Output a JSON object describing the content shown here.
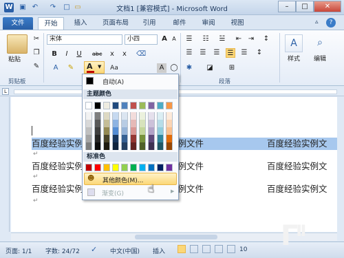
{
  "title": "文档1 [兼容模式] - Microsoft Word",
  "tabs": {
    "file": "文件",
    "items": [
      "开始",
      "插入",
      "页面布局",
      "引用",
      "邮件",
      "审阅",
      "视图"
    ]
  },
  "ribbon": {
    "paste_label": "粘贴",
    "clipboard_group": "剪贴板",
    "font_name": "宋体",
    "font_size": "小四",
    "paragraph_group": "段落",
    "style_label": "样式",
    "edit_label": "编辑",
    "font_color_hex": "#c00000"
  },
  "color_menu": {
    "auto_label": "自动(A)",
    "theme_header": "主题颜色",
    "theme_top_row": [
      "#ffffff",
      "#000000",
      "#eeece1",
      "#1f497d",
      "#4f81bd",
      "#c0504d",
      "#9bbb59",
      "#8064a2",
      "#4bacc6",
      "#f79646"
    ],
    "theme_shades": [
      [
        "#f2f2f2",
        "#7f7f7f",
        "#ddd9c3",
        "#c6d9f0",
        "#dbe5f1",
        "#f2dcdb",
        "#ebf1dd",
        "#e5e0ec",
        "#dbeef3",
        "#fdeada"
      ],
      [
        "#d8d8d8",
        "#595959",
        "#c4bd97",
        "#8db3e2",
        "#b8cce4",
        "#e5b9b7",
        "#d7e3bc",
        "#ccc1d9",
        "#b7dde8",
        "#fbd5b5"
      ],
      [
        "#bfbfbf",
        "#3f3f3f",
        "#938953",
        "#548dd4",
        "#95b3d7",
        "#d99694",
        "#c3d69b",
        "#b2a2c7",
        "#92cddc",
        "#fac08f"
      ],
      [
        "#a5a5a5",
        "#262626",
        "#494429",
        "#17365d",
        "#366092",
        "#953734",
        "#76923c",
        "#5f497a",
        "#31859b",
        "#e36c09"
      ],
      [
        "#7f7f7f",
        "#0c0c0c",
        "#1d1b10",
        "#0f243e",
        "#244061",
        "#632423",
        "#4f6128",
        "#3f3151",
        "#205867",
        "#974806"
      ]
    ],
    "standard_header": "标准色",
    "standard_colors": [
      "#c00000",
      "#ff0000",
      "#ffc000",
      "#ffff00",
      "#92d050",
      "#00b050",
      "#00b0f0",
      "#0070c0",
      "#002060",
      "#7030a0"
    ],
    "more_colors": "其他颜色(M)...",
    "gradient": "渐变(G)"
  },
  "document": {
    "lines": [
      {
        "left": "百度经验实例",
        "mid": "实例文件",
        "right": "百度经验实例文",
        "selected": true
      },
      {
        "left": "百度经验实例",
        "mid": "实例文件",
        "right": "百度经验实例文",
        "selected": false
      },
      {
        "left": "百度经验实例",
        "mid": "实例文件",
        "right": "百度经验实例文",
        "selected": false
      }
    ]
  },
  "status": {
    "page": "页面: 1/1",
    "words": "字数: 24/72",
    "lang": "中文(中国)",
    "mode": "插入",
    "zoom": "10"
  }
}
